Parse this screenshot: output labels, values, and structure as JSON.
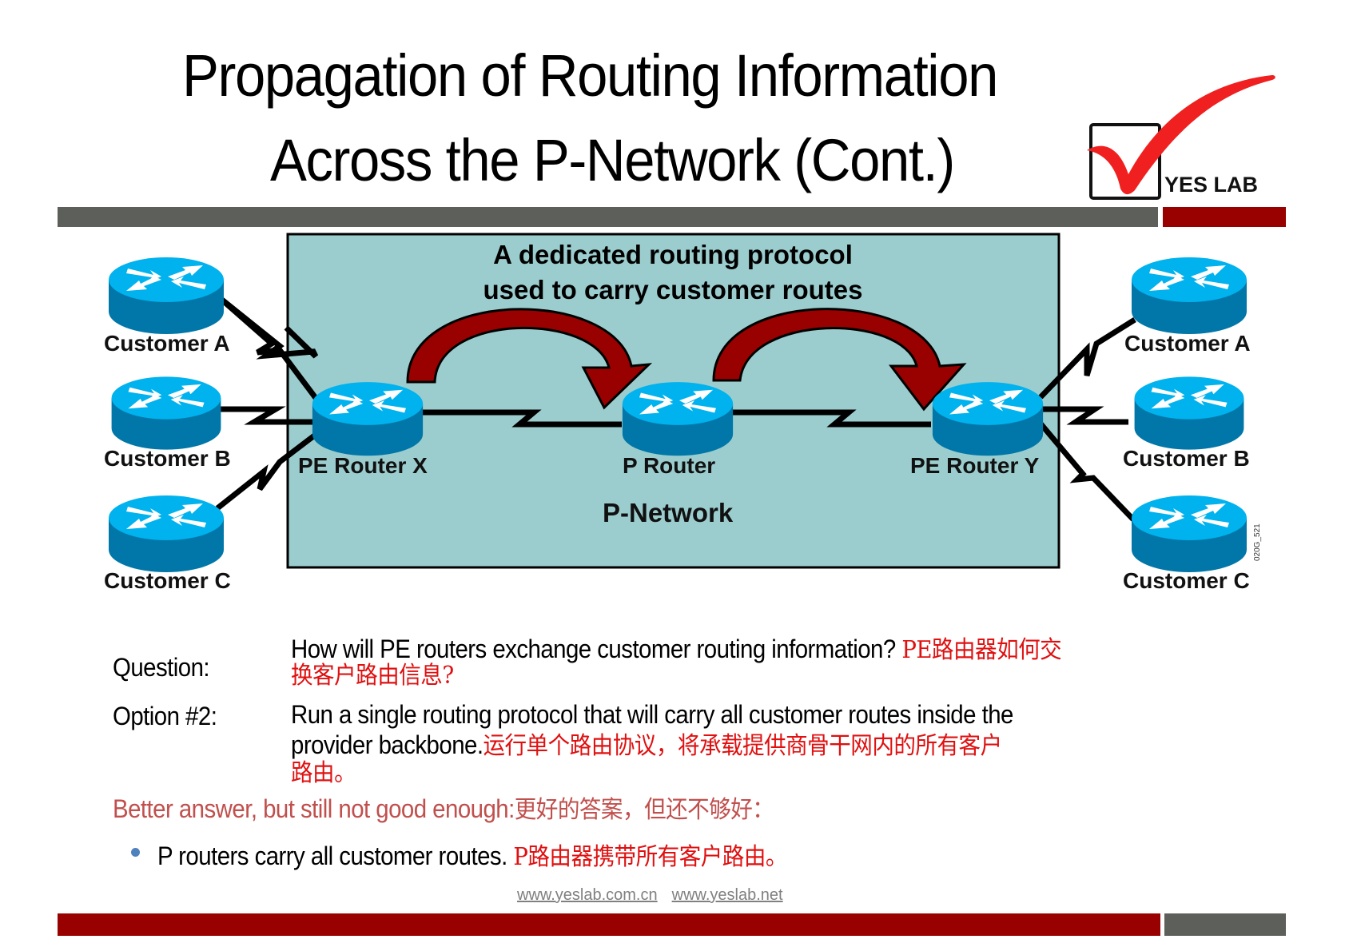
{
  "slide": {
    "title_line1": "Propagation of Routing Information",
    "title_line2": "Across the P-Network (Cont.)",
    "logo": {
      "text": "YES LAB",
      "icon": "checkmark-checkbox-icon",
      "check_color": "#f02020"
    }
  },
  "colors": {
    "bar_gray": "#5d5f5b",
    "bar_red": "#990000",
    "pnetwork_fill": "#9ccdce",
    "arrow_fill": "#990000",
    "router_top": "#00b2ee",
    "router_side": "#0077a8",
    "chinese_text": "#e01010",
    "better_answer": "#c0504d"
  },
  "diagram": {
    "header_line1": "A dedicated routing protocol",
    "header_line2": "used to carry customer routes",
    "network_label": "P-Network",
    "figure_id": "020G_521",
    "routers": {
      "left_customer_a": "Customer A",
      "left_customer_b": "Customer B",
      "left_customer_c": "Customer C",
      "pe_x": "PE Router X",
      "p_router": "P Router",
      "pe_y": "PE Router Y",
      "right_customer_a": "Customer A",
      "right_customer_b": "Customer B",
      "right_customer_c": "Customer C"
    }
  },
  "content": {
    "question_label": "Question:",
    "question_en": "How will PE routers exchange customer routing  information?",
    "question_cn_1": "PE路由器如何交",
    "question_cn_2": "换客户路由信息?",
    "option_label": "Option #2:",
    "option_en_1": "Run a single routing protocol that will carry all customer routes  inside  the",
    "option_en_2": "provider backbone.",
    "option_cn_1": "运行单个路由协议，将承载提供商骨干网内的所有客户",
    "option_cn_2": "路由。",
    "better_answer_en": "Better answer, but still  not good enough:",
    "better_answer_cn": "更好的答案，但还不够好：",
    "bullet_en": "P routers carry all customer  routes.",
    "bullet_cn": "P路由器携带所有客户路由。",
    "bullet_color": "#4f81bd"
  },
  "footer": {
    "link1": "www.yeslab.com.cn",
    "link2": "www.yeslab.net"
  }
}
